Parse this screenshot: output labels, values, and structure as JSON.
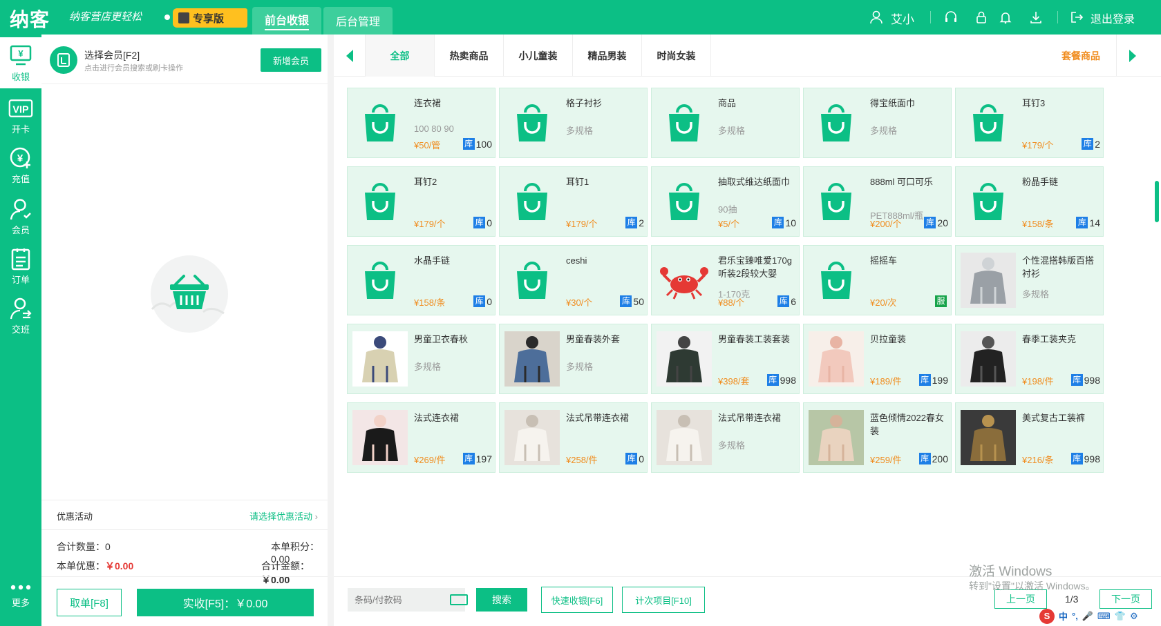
{
  "brand": {
    "logo": "纳客",
    "slogan": "纳客营店更轻松",
    "edition": "专享版"
  },
  "topnav": {
    "front": "前台收银",
    "back": "后台管理"
  },
  "user": {
    "name": "艾小",
    "logout": "退出登录"
  },
  "sidebar": [
    {
      "label": "收银",
      "icon": "cashier-icon"
    },
    {
      "label": "开卡",
      "icon": "vip-card-icon"
    },
    {
      "label": "充值",
      "icon": "recharge-icon"
    },
    {
      "label": "会员",
      "icon": "member-icon"
    },
    {
      "label": "订单",
      "icon": "order-icon"
    },
    {
      "label": "交班",
      "icon": "shift-icon"
    },
    {
      "label": "更多",
      "icon": "more-icon"
    }
  ],
  "member": {
    "title": "选择会员[F2]",
    "hint": "点击进行会员搜索或刷卡操作",
    "add_button": "新增会员"
  },
  "promo": {
    "label": "优惠活动",
    "select": "请选择优惠活动"
  },
  "summary": {
    "qty_label": "合计数量：",
    "qty": "0",
    "points_label": "本单积分：",
    "points": "0.00",
    "discount_label": "本单优惠：",
    "discount": "￥0.00",
    "total_label": "合计金额：",
    "total": "￥0.00"
  },
  "actions": {
    "cancel": "取单[F8]",
    "pay": "实收[F5]：￥0.00"
  },
  "categories": [
    "全部",
    "热卖商品",
    "小儿童装",
    "精品男装",
    "时尚女装"
  ],
  "combo_label": "套餐商品",
  "products": [
    {
      "name": "连衣裙",
      "spec": "100 80 90",
      "price": "¥50/管",
      "stock_tag": "库",
      "stock": "100",
      "thumb": "bag"
    },
    {
      "name": "格子衬衫",
      "spec": "多规格",
      "price": "",
      "stock_tag": "",
      "stock": "",
      "thumb": "bag"
    },
    {
      "name": "商品",
      "spec": "多规格",
      "price": "",
      "stock_tag": "",
      "stock": "",
      "thumb": "bag"
    },
    {
      "name": "得宝纸面巾",
      "spec": "多规格",
      "price": "",
      "stock_tag": "",
      "stock": "",
      "thumb": "bag"
    },
    {
      "name": "耳钉3",
      "spec": "",
      "price": "¥179/个",
      "stock_tag": "库",
      "stock": "2",
      "thumb": "bag"
    },
    {
      "name": "耳钉2",
      "spec": "",
      "price": "¥179/个",
      "stock_tag": "库",
      "stock": "0",
      "thumb": "bag"
    },
    {
      "name": "耳钉1",
      "spec": "",
      "price": "¥179/个",
      "stock_tag": "库",
      "stock": "2",
      "thumb": "bag"
    },
    {
      "name": "抽取式维达纸面巾",
      "spec": "90抽",
      "price": "¥5/个",
      "stock_tag": "库",
      "stock": "10",
      "thumb": "bag"
    },
    {
      "name": "888ml 可口可乐",
      "spec": "PET888ml/瓶",
      "price": "¥200/个",
      "stock_tag": "库",
      "stock": "20",
      "thumb": "bag"
    },
    {
      "name": "粉晶手链",
      "spec": "",
      "price": "¥158/条",
      "stock_tag": "库",
      "stock": "14",
      "thumb": "bag"
    },
    {
      "name": "水晶手链",
      "spec": "",
      "price": "¥158/条",
      "stock_tag": "库",
      "stock": "0",
      "thumb": "bag"
    },
    {
      "name": "ceshi",
      "spec": "",
      "price": "¥30/个",
      "stock_tag": "库",
      "stock": "50",
      "thumb": "bag"
    },
    {
      "name": "君乐宝臻唯爱170g听装2段较大婴",
      "spec": "1-170克",
      "price": "¥88/个",
      "stock_tag": "库",
      "stock": "6",
      "thumb": "crab"
    },
    {
      "name": "摇摇车",
      "spec": "",
      "price": "¥20/次",
      "stock_tag": "服",
      "stock": "",
      "thumb": "bag"
    },
    {
      "name": "个性混搭韩版百搭衬衫",
      "spec": "多规格",
      "price": "",
      "stock_tag": "",
      "stock": "",
      "thumb": "photo-grey"
    },
    {
      "name": "男童卫衣春秋",
      "spec": "多规格",
      "price": "",
      "stock_tag": "",
      "stock": "",
      "thumb": "photo-boy"
    },
    {
      "name": "男童春装外套",
      "spec": "多规格",
      "price": "",
      "stock_tag": "",
      "stock": "",
      "thumb": "photo-denim"
    },
    {
      "name": "男童春装工装套装",
      "spec": "",
      "price": "¥398/套",
      "stock_tag": "库",
      "stock": "998",
      "thumb": "photo-dark"
    },
    {
      "name": "贝拉童装",
      "spec": "",
      "price": "¥189/件",
      "stock_tag": "库",
      "stock": "199",
      "thumb": "photo-pink"
    },
    {
      "name": "春季工装夹克",
      "spec": "",
      "price": "¥198/件",
      "stock_tag": "库",
      "stock": "998",
      "thumb": "photo-black"
    },
    {
      "name": "法式连衣裙",
      "spec": "",
      "price": "¥269/件",
      "stock_tag": "库",
      "stock": "197",
      "thumb": "photo-dress-black"
    },
    {
      "name": "法式吊带连衣裙",
      "spec": "",
      "price": "¥258/件",
      "stock_tag": "库",
      "stock": "0",
      "thumb": "photo-dress-white"
    },
    {
      "name": "法式吊带连衣裙",
      "spec": "多规格",
      "price": "",
      "stock_tag": "",
      "stock": "",
      "thumb": "photo-dress-white"
    },
    {
      "name": "蓝色倾情2022春女装",
      "spec": "",
      "price": "¥259/件",
      "stock_tag": "库",
      "stock": "200",
      "thumb": "photo-beige"
    },
    {
      "name": "美式复古工装裤",
      "spec": "",
      "price": "¥216/条",
      "stock_tag": "库",
      "stock": "998",
      "thumb": "photo-camo"
    }
  ],
  "bottom": {
    "barcode_placeholder": "条码/付款码",
    "search": "搜索",
    "quick_pay": "快速收银[F6]",
    "count_item": "计次项目[F10]",
    "prev": "上一页",
    "page": "1/3",
    "next": "下一页"
  },
  "watermark": {
    "line1": "激活 Windows",
    "line2": "转到\"设置\"以激活 Windows。"
  },
  "tray": {
    "ime": "中"
  },
  "colors": {
    "brand": "#0cbf85",
    "price": "#f08c1e",
    "stock_badge": "#1e7fe6"
  }
}
